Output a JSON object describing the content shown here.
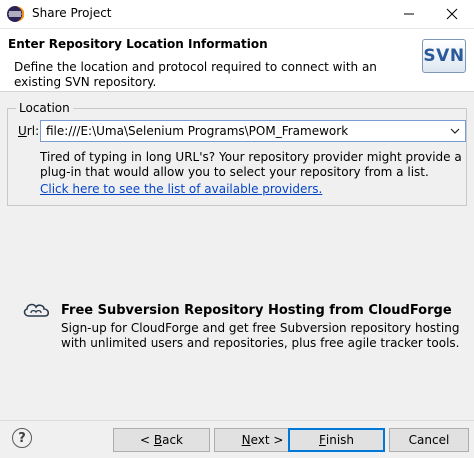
{
  "window": {
    "title": "Share Project"
  },
  "header": {
    "title": "Enter Repository Location Information",
    "description": "Define the location and protocol required to connect with an existing SVN repository.",
    "logo_text": "SVN"
  },
  "location": {
    "group_label": "Location",
    "url_label_mnemonic": "U",
    "url_label_rest": "rl:",
    "url_value": "file:///E:\\Uma\\Selenium Programs\\POM_Framework",
    "hint": "Tired of typing in long URL's?  Your repository provider might provide a plug-in that would allow you to select your repository from a list.",
    "providers_link": "Click here to see the list of available providers."
  },
  "cloudforge": {
    "title": "Free Subversion Repository Hosting from CloudForge",
    "description": "Sign-up for CloudForge and get free Subversion repository hosting with unlimited users and repositories, plus free agile tracker tools."
  },
  "buttons": {
    "back_prefix": "< ",
    "back_mnemonic": "B",
    "back_rest": "ack",
    "next_mnemonic": "N",
    "next_rest": "ext >",
    "finish_mnemonic": "F",
    "finish_rest": "inish",
    "cancel": "Cancel"
  },
  "colors": {
    "link": "#0645c8",
    "focus_border": "#0078d7",
    "svn_blue": "#2a5a9a"
  }
}
